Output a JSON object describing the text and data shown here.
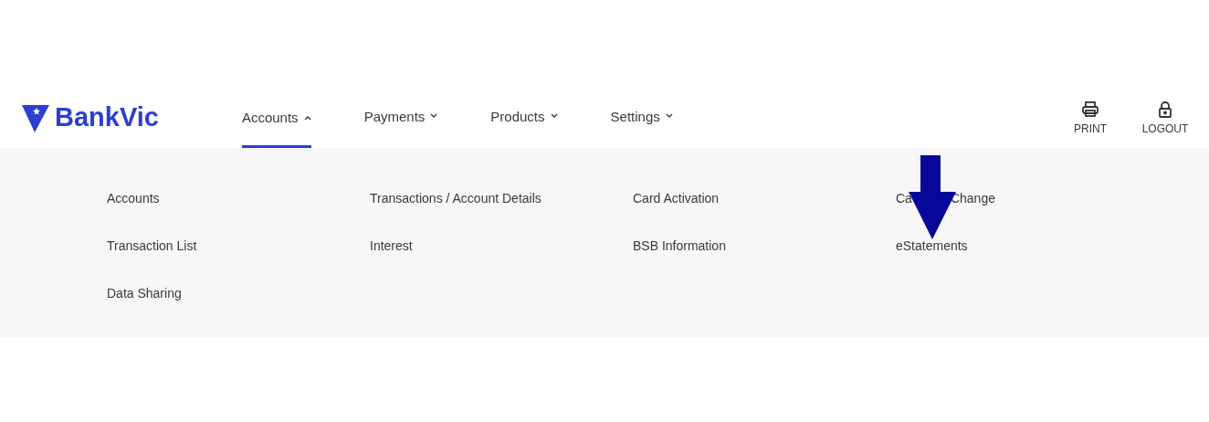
{
  "logo": {
    "text": "BankVic"
  },
  "nav": [
    {
      "label": "Accounts",
      "selected": true,
      "expanded": true
    },
    {
      "label": "Payments",
      "selected": false,
      "expanded": false
    },
    {
      "label": "Products",
      "selected": false,
      "expanded": false
    },
    {
      "label": "Settings",
      "selected": false,
      "expanded": false
    }
  ],
  "actions": [
    {
      "kind": "print",
      "label": "PRINT"
    },
    {
      "kind": "logout",
      "label": "LOGOUT"
    }
  ],
  "menu_columns": [
    [
      {
        "label_parts": [
          "Accounts"
        ]
      },
      {
        "label_parts": [
          "Transaction List"
        ]
      },
      {
        "label_parts": [
          "Data Sharing"
        ]
      }
    ],
    [
      {
        "label_parts": [
          "Transactions / Account Details"
        ]
      },
      {
        "label_parts": [
          "Interest"
        ]
      }
    ],
    [
      {
        "label_parts": [
          "Card Activation"
        ]
      },
      {
        "label_parts": [
          "BSB Information"
        ]
      }
    ],
    [
      {
        "label_parts": [
          "Ca",
          "Change"
        ]
      },
      {
        "label_parts": [
          "eStatements"
        ]
      }
    ]
  ]
}
